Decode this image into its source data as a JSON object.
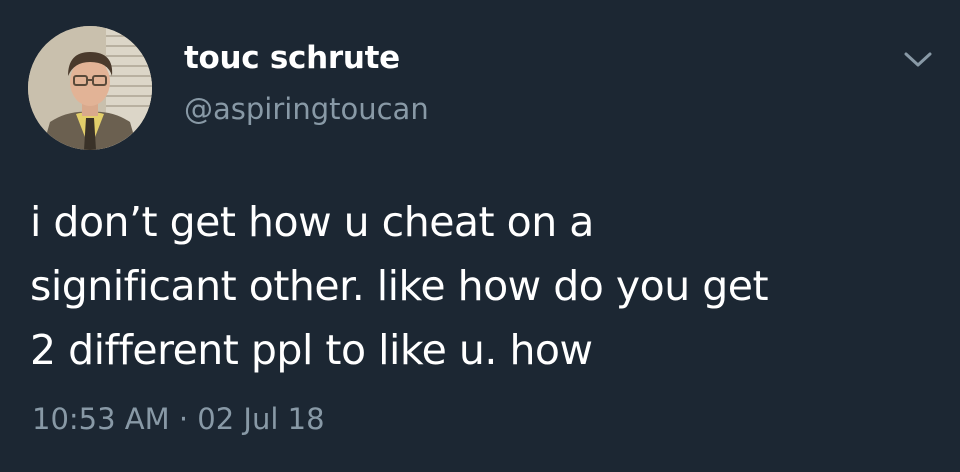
{
  "author": {
    "display_name": "touc schrute",
    "handle": "@aspiringtoucan"
  },
  "tweet": {
    "lines": [
      "i don’t get how u cheat on a",
      "significant other. like how do you get",
      "2 different ppl to like u. how"
    ],
    "timestamp": "10:53 AM · 02 Jul 18"
  },
  "icons": {
    "menu": "chevron-down-icon",
    "avatar": "avatar"
  },
  "colors": {
    "background": "#1c2733",
    "primary_text": "#ffffff",
    "secondary_text": "#8899a6"
  }
}
